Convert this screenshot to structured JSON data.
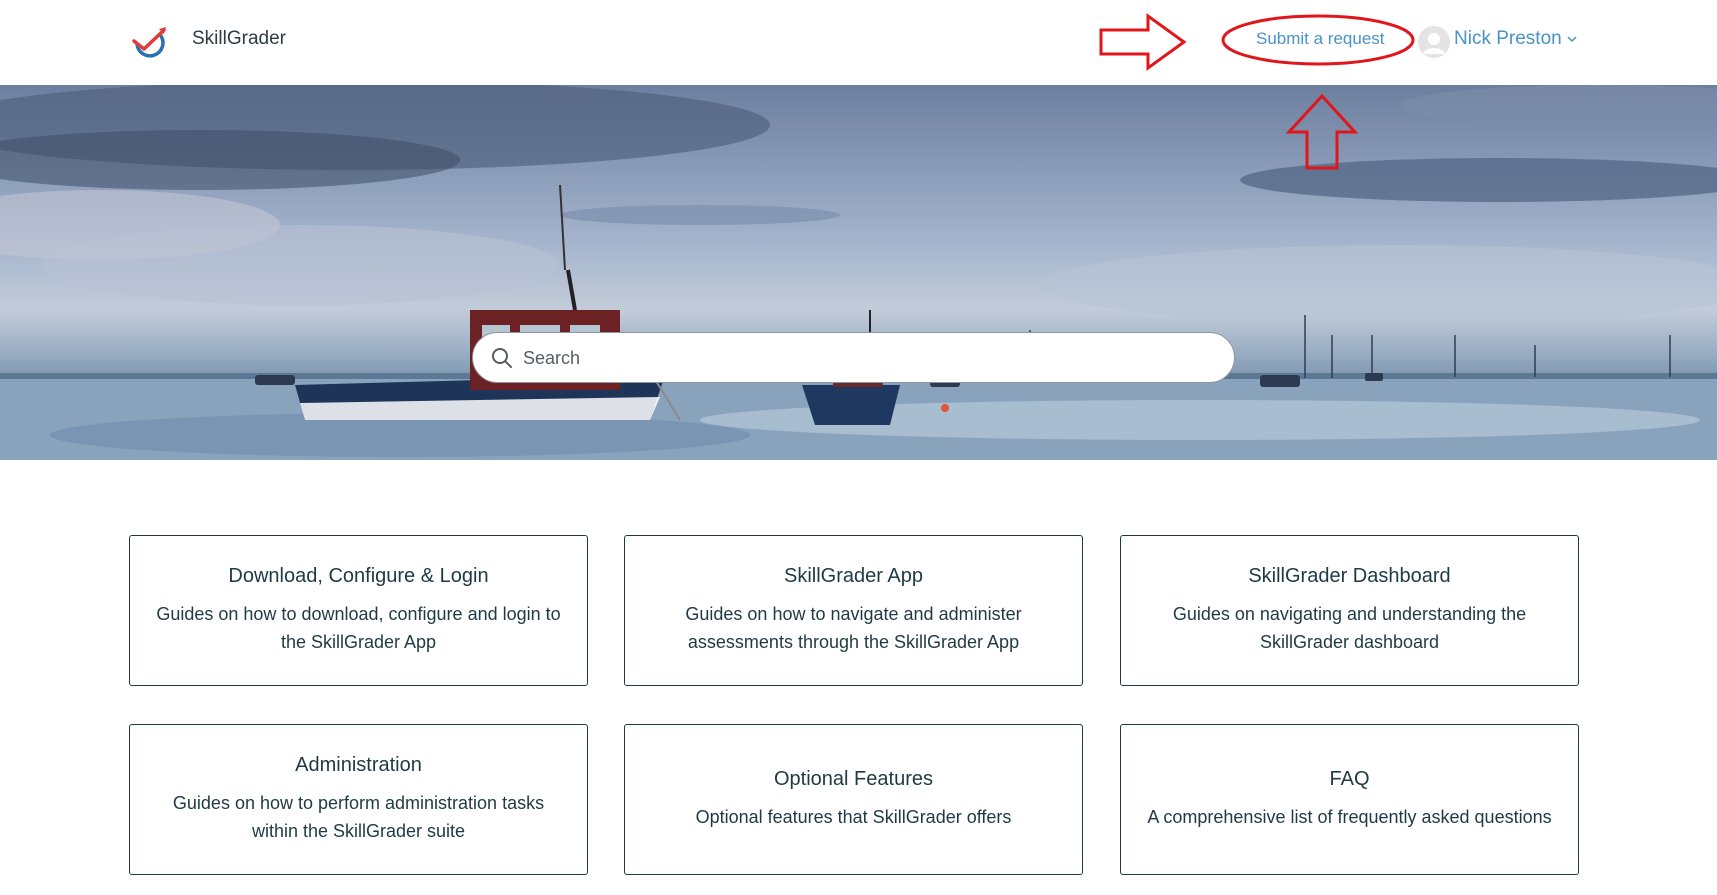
{
  "header": {
    "brand": "SkillGrader",
    "submit_request": "Submit a request",
    "user_name": "Nick Preston"
  },
  "search": {
    "placeholder": "Search"
  },
  "categories": [
    {
      "title": "Download, Configure & Login",
      "description": "Guides on how to download, configure and login to the SkillGrader App"
    },
    {
      "title": "SkillGrader App",
      "description": "Guides on how to navigate and administer assessments through the SkillGrader App"
    },
    {
      "title": "SkillGrader Dashboard",
      "description": "Guides on navigating and understanding the SkillGrader dashboard"
    },
    {
      "title": "Administration",
      "description": "Guides on how to perform administration tasks within the SkillGrader suite"
    },
    {
      "title": "Optional Features",
      "description": "Optional features that SkillGrader offers"
    },
    {
      "title": "FAQ",
      "description": "A comprehensive list of frequently asked questions"
    }
  ],
  "colors": {
    "link": "#4a93c6",
    "text": "#1f3a44",
    "annotation": "#e0161b"
  }
}
